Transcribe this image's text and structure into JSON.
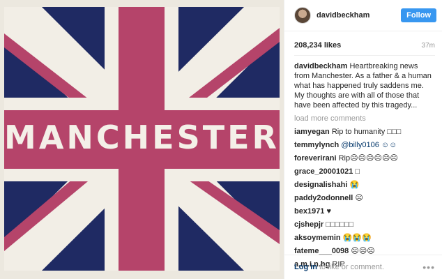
{
  "post": {
    "username": "davidbeckham",
    "follow_label": "Follow",
    "likes": "208,234 likes",
    "time_ago": "37m",
    "caption_user": "davidbeckham",
    "caption_text": "Heartbreaking news from Manchester. As a father & a human what has happened truly saddens me. My thoughts are with all of those that have been affected by this tragedy...",
    "load_more": "load more comments",
    "image_text": "MANCHESTER",
    "comments": [
      {
        "user": "iamyegan",
        "text": "Rip to humanity □□□"
      },
      {
        "user": "temmylynch",
        "text": "@billy0106 ☺☺"
      },
      {
        "user": "foreverirani",
        "text": "Rip☹☹☹☹☹☹"
      },
      {
        "user": "grace_20001021",
        "text": "□"
      },
      {
        "user": "designalishahi",
        "text": "😭"
      },
      {
        "user": "paddy2odonnell",
        "text": "☹"
      },
      {
        "user": "bex1971",
        "text": "♥"
      },
      {
        "user": "cjshepjr",
        "text": "□□□□□□"
      },
      {
        "user": "aksoymemin",
        "text": "😭😭😭"
      },
      {
        "user": "fateme___0098",
        "text": "☹☹☹"
      },
      {
        "user": "a.m.i.n.hg",
        "text": "RIP"
      }
    ],
    "footer_login": "Log in",
    "footer_rest": "to like or comment.",
    "more_icon": "more-options-icon",
    "colors": {
      "flag_red": "#b5446a",
      "flag_blue": "#1f2a63",
      "flag_white": "#f2eee6",
      "accent": "#3897f0"
    }
  }
}
